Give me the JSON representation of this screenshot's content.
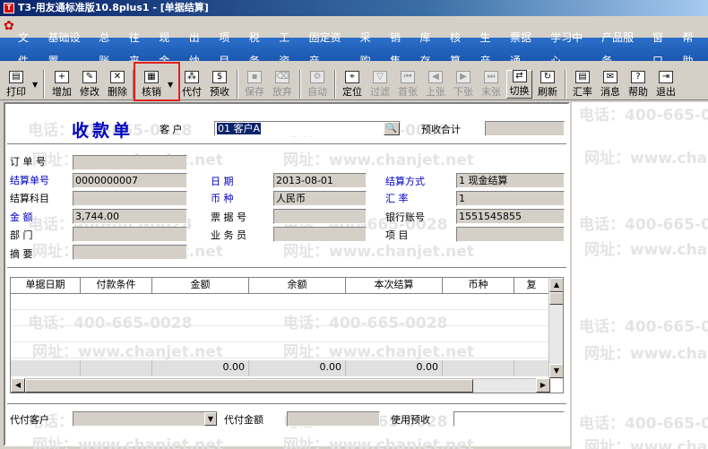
{
  "window": {
    "title": "T3-用友通标准版10.8plus1 - [单据结算]"
  },
  "menu": [
    "文件",
    "基础设置",
    "总账",
    "往来",
    "现金",
    "出纳",
    "项目",
    "税务",
    "工资",
    "固定资产",
    "采购",
    "销售",
    "库存",
    "核算",
    "生产",
    "票据通",
    "学习中心",
    "产品服务",
    "窗口",
    "帮助"
  ],
  "toolbar": {
    "print": "打印",
    "add": "增加",
    "modify": "修改",
    "delete": "删除",
    "writeoff": "核销",
    "agent": "代付",
    "advance": "预收",
    "save": "保存",
    "abandon": "放弃",
    "auto": "自动",
    "locate": "定位",
    "filter": "过滤",
    "first": "首张",
    "prev": "上张",
    "next": "下张",
    "last": "末张",
    "switch": "切换",
    "refresh": "刷新",
    "rate": "汇率",
    "message": "消息",
    "help": "帮助",
    "exit": "退出"
  },
  "form": {
    "title": "收款单",
    "customer_label": "客  户",
    "customer_value": "01 客户A",
    "advance_total_label": "预收合计",
    "advance_total_value": "",
    "order_no_label": "订 单 号",
    "order_no_value": "",
    "settle_no_label": "结算单号",
    "settle_no_value": "0000000007",
    "date_label": "日   期",
    "date_value": "2013-08-01",
    "settle_method_label": "结算方式",
    "settle_method_value": "1  现金结算",
    "settle_subject_label": "结算科目",
    "settle_subject_value": "",
    "currency_label": "币   种",
    "currency_value": "人民币",
    "exchange_rate_label": "汇   率",
    "exchange_rate_value": "1",
    "amount_label": "金   额",
    "amount_value": "3,744.00",
    "bill_no_label": "票 据 号",
    "bill_no_value": "",
    "bank_account_label": "银行账号",
    "bank_account_value": "1551545855",
    "department_label": "部   门",
    "department_value": "",
    "salesperson_label": "业 务 员",
    "salesperson_value": "",
    "project_label": "项   目",
    "project_value": "",
    "summary_label": "摘   要",
    "summary_value": ""
  },
  "grid": {
    "columns": [
      "单据日期",
      "付款条件",
      "金额",
      "余额",
      "本次结算",
      "币种",
      "复"
    ],
    "totals": [
      "",
      "",
      "0.00",
      "0.00",
      "0.00",
      "",
      ""
    ]
  },
  "footer": {
    "agent_customer_label": "代付客户",
    "agent_amount_label": "代付金额",
    "use_advance_label": "使用预收"
  },
  "watermarks": {
    "phone": "电话：400-665-0028",
    "site": "网址：www.chanjet.net"
  }
}
